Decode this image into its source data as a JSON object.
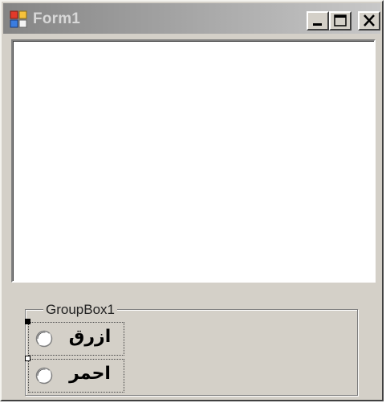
{
  "window": {
    "title": "Form1",
    "controls": {
      "minimize_icon": "minimize-icon",
      "maximize_icon": "maximize-icon",
      "close_icon": "close-icon"
    },
    "app_icon": "form-app-icon"
  },
  "textarea": {
    "value": ""
  },
  "groupbox": {
    "label": "GroupBox1",
    "options": [
      {
        "label": "ازرق",
        "checked": false
      },
      {
        "label": "احمر",
        "checked": false
      }
    ]
  },
  "colors": {
    "face": "#d4d0c8",
    "titlebar_start": "#858585",
    "titlebar_end": "#c8c8c8",
    "title_text": "#d8d8d8"
  }
}
